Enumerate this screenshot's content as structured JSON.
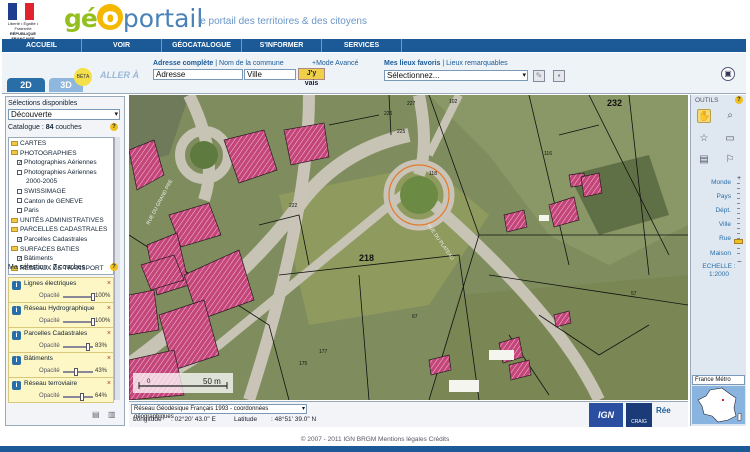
{
  "header": {
    "republique": [
      "Liberté • Égalité • Fraternité",
      "RÉPUBLIQUE FRANÇAISE"
    ],
    "logo_a": "gé",
    "logo_o": "o",
    "logo_b": "portail",
    "tagline": "le portail des territoires & des citoyens",
    "flag_colors": [
      "#1f3d8f",
      "#ffffff",
      "#e1232f"
    ]
  },
  "nav": [
    "ACCUEIL",
    "VOIR",
    "GÉOCATALOGUE",
    "S'INFORMER",
    "SERVICES"
  ],
  "toolbar": {
    "tab_2d": "2D",
    "tab_3d": "3D",
    "beta": "BÉTA",
    "aller_a": "ALLER À",
    "adresse_label": "Adresse complète",
    "nom_commune": "Nom de la commune",
    "mode_avance": "+Mode Avancé",
    "adresse_value": "Adresse",
    "ville_value": "Ville",
    "jyvais": "J'y vais",
    "favoris_label": "Mes lieux favoris",
    "lieux_remarquables": "Lieux remarquables",
    "select_value": "Sélectionnez..."
  },
  "left": {
    "selections_label": "Sélections disponibles",
    "selection_value": "Découverte",
    "catalogue_prefix": "Catalogue : ",
    "catalogue_count": "84",
    "catalogue_suffix": " couches",
    "tree": [
      {
        "t": "folder",
        "label": "CARTES"
      },
      {
        "t": "folder",
        "label": "PHOTOGRAPHIES"
      },
      {
        "t": "check",
        "checked": true,
        "label": "Photographies Aériennes"
      },
      {
        "t": "check",
        "checked": false,
        "label": "Photographies Aériennes"
      },
      {
        "t": "plain",
        "label": "2000-2005"
      },
      {
        "t": "check",
        "checked": false,
        "label": "SWISSIMAGE"
      },
      {
        "t": "check",
        "checked": false,
        "label": "Canton de GENEVE"
      },
      {
        "t": "check",
        "checked": false,
        "label": "Paris"
      },
      {
        "t": "folder",
        "label": "UNITÉS ADMINISTRATIVES"
      },
      {
        "t": "folder",
        "label": "PARCELLES CADASTRALES"
      },
      {
        "t": "check",
        "checked": true,
        "label": "Parcelles Cadastrales"
      },
      {
        "t": "folder",
        "label": "SURFACES BATIES"
      },
      {
        "t": "check",
        "checked": true,
        "label": "Bâtiments"
      },
      {
        "t": "folder",
        "label": "RESEAUX DE TRANSPORT"
      }
    ],
    "ma_selection_prefix": "Ma sélection : ",
    "ma_selection_count": "7",
    "ma_selection_suffix": " couches",
    "opacity_label": "Opacité",
    "layers": [
      {
        "name": "Lignes électriques",
        "pct": "100%",
        "level": 1.0
      },
      {
        "name": "Réseau Hydrographique",
        "pct": "100%",
        "level": 1.0
      },
      {
        "name": "Parcelles Cadastrales",
        "pct": "83%",
        "level": 0.83
      },
      {
        "name": "Bâtiments",
        "pct": "43%",
        "level": 0.43
      },
      {
        "name": "Réseau terroviaire",
        "pct": "64%",
        "level": 0.64
      }
    ]
  },
  "map": {
    "parcels": [
      "232",
      "218",
      "222",
      "116",
      "225",
      "226",
      "227",
      "118",
      "102",
      "177",
      "175",
      "57",
      "67"
    ],
    "road_labels": [
      "RUE DU GRAND PRE",
      "RUE DU PLATEAU"
    ],
    "scale_text": "50 m"
  },
  "status": {
    "crs": "Réseau Géodésique Français 1993 - coordonnées géographiques",
    "longitude_label": "Longitude",
    "longitude_value": ": 02°20' 43.0\" E",
    "latitude_label": "Latitude",
    "latitude_value": ": 48°51' 39.0\" N",
    "logos": [
      "IGN",
      "CRAIG",
      "Rée"
    ]
  },
  "right": {
    "outils": "OUTILS",
    "zoom_levels": [
      "Monde",
      "Pays",
      "Dépt.",
      "Ville",
      "Rue",
      "Maison"
    ],
    "echelle": "ECHELLE :",
    "echelle_value": "1:2000",
    "minimap_select": "France Métro"
  },
  "footer": "© 2007 - 2011 IGN BRGM Mentions légales Crédits"
}
